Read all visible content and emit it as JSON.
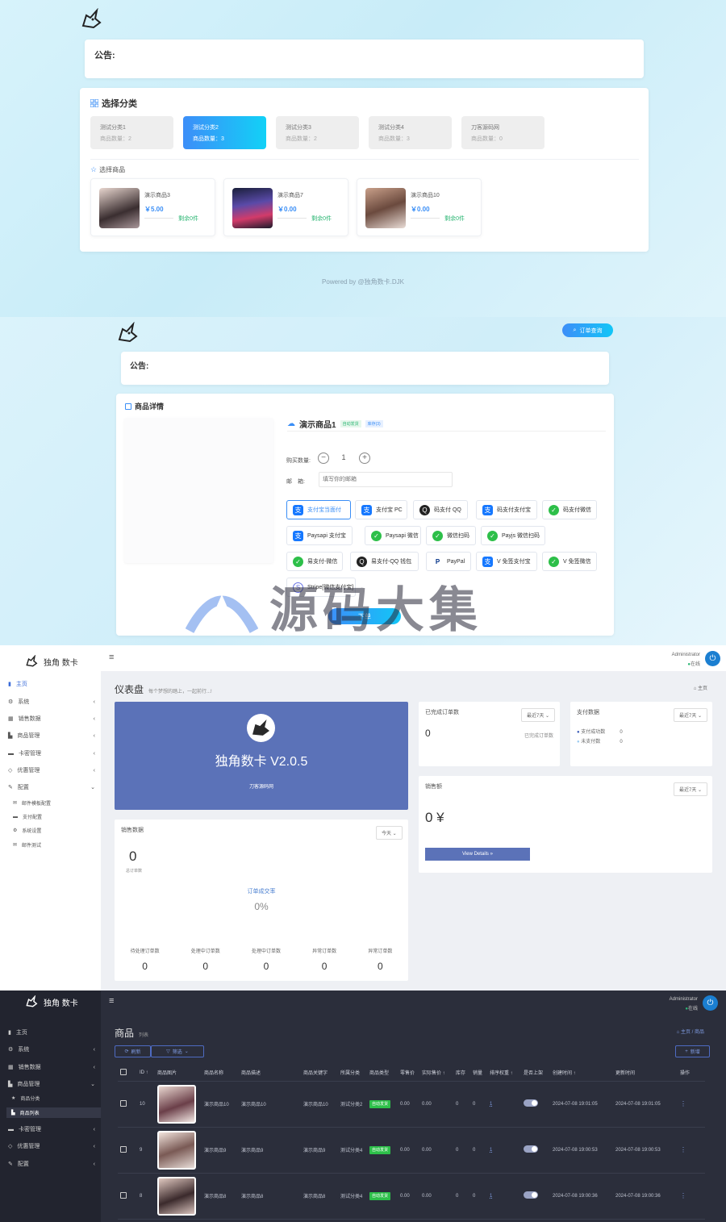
{
  "s1": {
    "announcement": "公告:",
    "category_title": "选择分类",
    "categories": [
      {
        "name": "测试分类1",
        "count": "商品数量：2"
      },
      {
        "name": "测试分类2",
        "count": "商品数量：3"
      },
      {
        "name": "测试分类3",
        "count": "商品数量：2"
      },
      {
        "name": "测试分类4",
        "count": "商品数量：3"
      },
      {
        "name": "刀客源码网",
        "count": "商品数量：0"
      }
    ],
    "product_title": "选择商品",
    "products": [
      {
        "name": "演示商品3",
        "price": "￥5.00",
        "stock": "剩余0件"
      },
      {
        "name": "演示商品7",
        "price": "￥0.00",
        "stock": "剩余0件"
      },
      {
        "name": "演示商品10",
        "price": "￥0.00",
        "stock": "剩余0件"
      }
    ],
    "footer": "Powered by @独角数卡.DJK"
  },
  "s2": {
    "order_query": "订单查询",
    "announcement": "公告:",
    "detail_title": "商品详情",
    "product_name": "演示商品1",
    "badge_auto": "自动发货",
    "badge_stock": "库存(3)",
    "qty_label": "购买数量:",
    "qty_value": "1",
    "email_label": "邮　箱:",
    "email_placeholder": "填写你的邮箱",
    "payments": [
      {
        "name": "支付宝当面付",
        "icon": "alipay-icon"
      },
      {
        "name": "支付宝 PC",
        "icon": "alipay-icon"
      },
      {
        "name": "码支付 QQ",
        "icon": "qq-icon"
      },
      {
        "name": "码支付支付宝",
        "icon": "alipay-icon"
      },
      {
        "name": "码支付微信",
        "icon": "wechat-icon"
      },
      {
        "name": "Paysapi 支付宝",
        "icon": "alipay-icon"
      },
      {
        "name": "Paysapi 微信",
        "icon": "wechat-icon"
      },
      {
        "name": "微信扫码",
        "icon": "wechat-icon"
      },
      {
        "name": "Payjs 微信扫码",
        "icon": "wechat-icon"
      },
      {
        "name": "易支付-微信",
        "icon": "wechat-icon"
      },
      {
        "name": "易支付-QQ 钱包",
        "icon": "qq-icon"
      },
      {
        "name": "PayPal",
        "icon": "paypal-icon"
      },
      {
        "name": "V 免签支付宝",
        "icon": "alipay-icon"
      },
      {
        "name": "V 免签微信",
        "icon": "wechat-icon"
      },
      {
        "name": "Stripe[微信支付宝]",
        "icon": "stripe-icon"
      }
    ],
    "submit": "下单",
    "watermark": "源码大集"
  },
  "s3": {
    "brand": "独角 数卡",
    "user": "Administrator",
    "status": "在线",
    "nav": [
      "主页",
      "系统",
      "销售数据",
      "商品管理",
      "卡密管理",
      "优惠管理",
      "配置"
    ],
    "subnav": [
      "邮件模板配置",
      "支付配置",
      "系统设置",
      "邮件测试"
    ],
    "page_title": "仪表盘",
    "page_sub": "每个梦想的踏上，一起前行...!",
    "crumb": "主页",
    "hero_title": "独角数卡 V2.0.5",
    "hero_sub": "刀客源码网",
    "done_orders": {
      "title": "已完成订单数",
      "range": "最近7天",
      "value": "0",
      "note": "已完成订单数"
    },
    "pay_data": {
      "title": "支付数据",
      "range": "最近7天",
      "items": [
        {
          "label": "支付成功数",
          "value": "0"
        },
        {
          "label": "未支付数",
          "value": "0"
        }
      ]
    },
    "sales_amount": {
      "title": "销售额",
      "range": "最近7天",
      "value": "0 ¥",
      "button": "View Details »"
    },
    "sales_data": {
      "title": "销售数据",
      "range": "今天",
      "total": "0",
      "total_label": "总订单数",
      "rate_label": "订单成交率",
      "rate": "0%",
      "stats": [
        {
          "label": "待处理订单数",
          "value": "0"
        },
        {
          "label": "处理中订单数",
          "value": "0"
        },
        {
          "label": "处理中订单数",
          "value": "0"
        },
        {
          "label": "异常订单数",
          "value": "0"
        },
        {
          "label": "异常订单数",
          "value": "0"
        }
      ]
    }
  },
  "s4": {
    "brand": "独角 数卡",
    "user": "Administrator",
    "status": "在线",
    "nav": [
      "主页",
      "系统",
      "销售数据",
      "商品管理",
      "商品分类",
      "商品列表",
      "卡密管理",
      "优惠管理",
      "配置"
    ],
    "page_title": "商品",
    "page_sub": "列表",
    "crumb_home": "主页",
    "crumb_cur": "商品",
    "refresh": "刷新",
    "filter": "筛选",
    "add": "新增",
    "headers": [
      "ID ↑",
      "商品图片",
      "商品名称",
      "商品描述",
      "商品关键字",
      "所属分类",
      "商品类型",
      "零售价",
      "实际售价 ↑",
      "库存",
      "销量",
      "排序权重 ↑",
      "是否上架",
      "创建时间 ↑",
      "更新时间",
      "操作"
    ],
    "rows": [
      {
        "id": "10",
        "name": "演示商品10",
        "desc": "演示商品10",
        "kw": "演示商品10",
        "cat": "测试分类2",
        "type": "自动发货",
        "retail": "0.00",
        "actual": "0.00",
        "stock": "0",
        "sales": "0",
        "ord": "1",
        "created": "2024-07-08 19:01:05",
        "updated": "2024-07-08 19:01:05"
      },
      {
        "id": "9",
        "name": "演示商品9",
        "desc": "演示商品9",
        "kw": "演示商品9",
        "cat": "测试分类4",
        "type": "自动发货",
        "retail": "0.00",
        "actual": "0.00",
        "stock": "0",
        "sales": "0",
        "ord": "1",
        "created": "2024-07-08 19:00:53",
        "updated": "2024-07-08 19:00:53"
      },
      {
        "id": "8",
        "name": "演示商品8",
        "desc": "演示商品8",
        "kw": "演示商品8",
        "cat": "测试分类4",
        "type": "自动发货",
        "retail": "0.00",
        "actual": "0.00",
        "stock": "0",
        "sales": "0",
        "ord": "1",
        "created": "2024-07-08 19:00:36",
        "updated": "2024-07-08 19:00:36"
      }
    ]
  },
  "colors": {
    "accent": "#3a8ef6",
    "hero": "#5b72b8",
    "green": "#2dbf49",
    "dark_bg": "#2b2e3b"
  }
}
